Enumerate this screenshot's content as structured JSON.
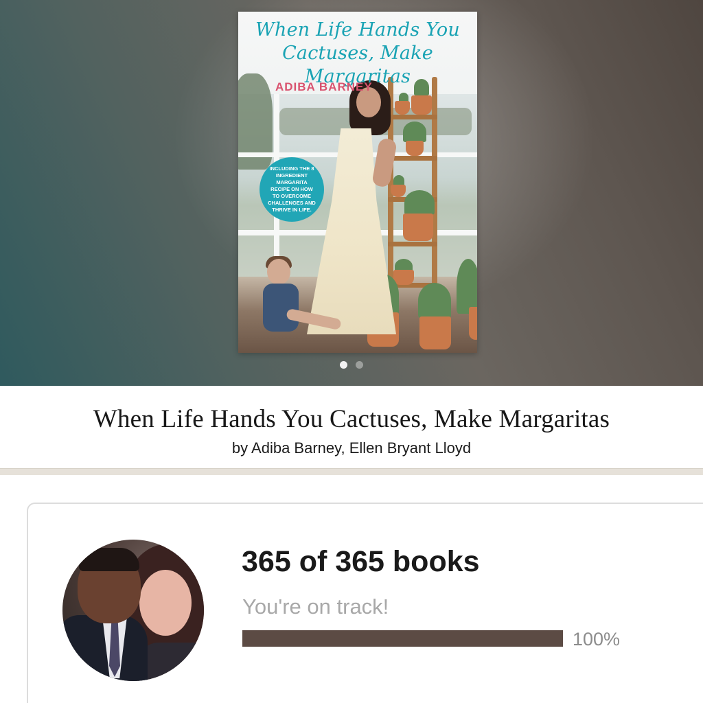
{
  "carousel": {
    "slide_count": 2,
    "active_index": 0
  },
  "cover": {
    "title": "When Life Hands You Cactuses, Make Margaritas",
    "author": "ADIBA BARNEY",
    "badge": "INCLUDING THE 8 INGREDIENT MARGARITA RECIPE ON HOW TO OVERCOME CHALLENGES AND THRIVE IN LIFE."
  },
  "book": {
    "title": "When Life Hands You Cactuses, Make Margaritas",
    "author_line": "by Adiba Barney, Ellen Bryant Lloyd"
  },
  "challenge": {
    "count_text": "365 of 365 books",
    "status_text": "You're on track!",
    "progress_fraction": 1.0,
    "progress_label": "100%",
    "progress_color": "#5c4b44"
  }
}
